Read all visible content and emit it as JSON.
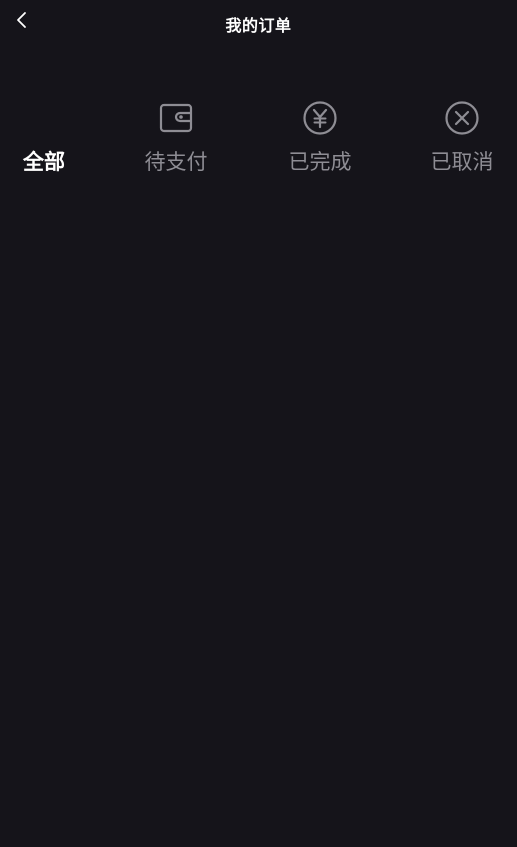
{
  "header": {
    "title": "我的订单",
    "back_icon": "chevron-left-icon"
  },
  "tabs": [
    {
      "label": "全部",
      "icon": "",
      "active": true
    },
    {
      "label": "待支付",
      "icon": "wallet-icon",
      "active": false
    },
    {
      "label": "已完成",
      "icon": "yuan-circle-icon",
      "active": false
    },
    {
      "label": "已取消",
      "icon": "x-circle-icon",
      "active": false
    }
  ],
  "colors": {
    "background": "#15141a",
    "active_text": "#ffffff",
    "inactive_text": "#8e8d94",
    "icon_stroke": "#8e8d94"
  }
}
